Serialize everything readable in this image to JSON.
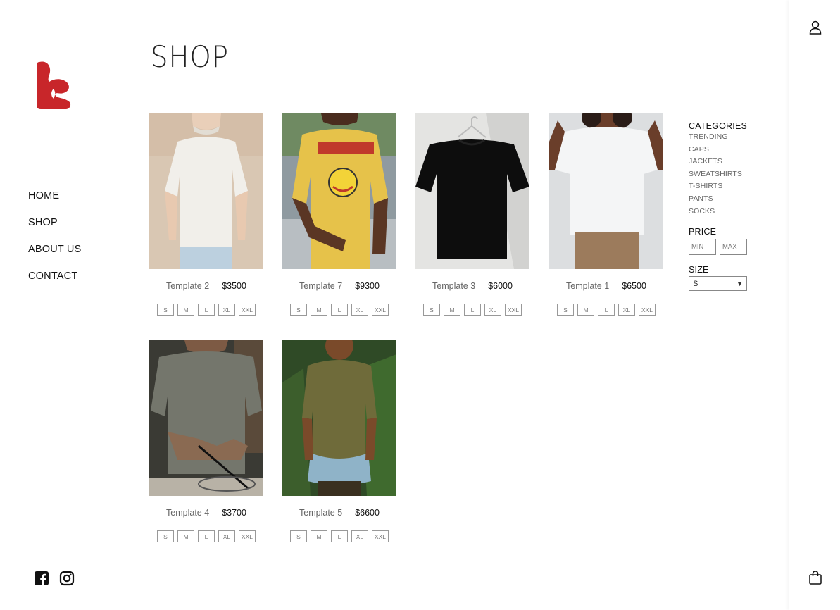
{
  "brand": {
    "logo_icon": "brand-s-logo",
    "color": "#c8262a"
  },
  "nav": [
    {
      "label": "HOME"
    },
    {
      "label": "SHOP"
    },
    {
      "label": "ABOUT US"
    },
    {
      "label": "CONTACT"
    }
  ],
  "page_title": "SHOP",
  "products": [
    {
      "name": "Template 2",
      "price": "$3500",
      "sizes": [
        "S",
        "M",
        "L",
        "XL",
        "XXL"
      ]
    },
    {
      "name": "Template 7",
      "price": "$9300",
      "sizes": [
        "S",
        "M",
        "L",
        "XL",
        "XXL"
      ]
    },
    {
      "name": "Template 3",
      "price": "$6000",
      "sizes": [
        "S",
        "M",
        "L",
        "XL",
        "XXL"
      ]
    },
    {
      "name": "Template 1",
      "price": "$6500",
      "sizes": [
        "S",
        "M",
        "L",
        "XL",
        "XXL"
      ]
    },
    {
      "name": "Template 4",
      "price": "$3700",
      "sizes": [
        "S",
        "M",
        "L",
        "XL",
        "XXL"
      ]
    },
    {
      "name": "Template 5",
      "price": "$6600",
      "sizes": [
        "S",
        "M",
        "L",
        "XL",
        "XXL"
      ]
    }
  ],
  "filters": {
    "categories_title": "CATEGORIES",
    "categories": [
      "TRENDING",
      "CAPS",
      "JACKETS",
      "SWEATSHIRTS",
      "T-SHIRTS",
      "PANTS",
      "SOCKS"
    ],
    "price_title": "PRICE",
    "min_placeholder": "MIN",
    "max_placeholder": "MAX",
    "size_title": "SIZE",
    "size_selected": "S"
  },
  "icons": {
    "social": [
      "facebook-icon",
      "instagram-icon"
    ],
    "account": "user-icon",
    "cart": "shopping-bag-icon"
  }
}
